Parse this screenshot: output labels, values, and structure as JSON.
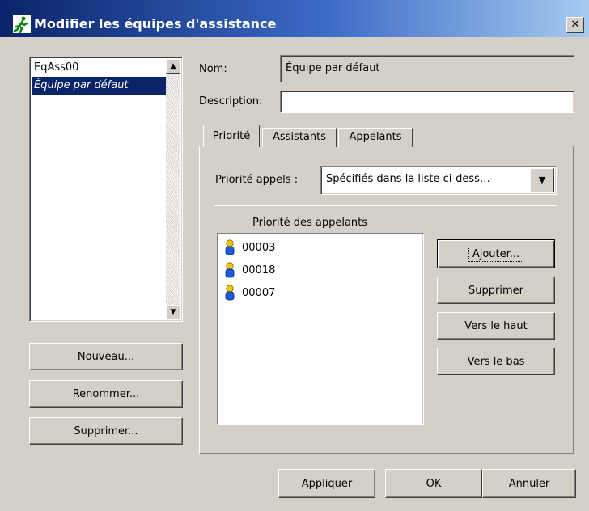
{
  "window": {
    "title": "Modifier les équipes d'assistance",
    "close_glyph": "✕"
  },
  "teams": {
    "items": [
      {
        "label": "EqAss00",
        "selected": false
      },
      {
        "label": "Équipe par défaut",
        "selected": true
      }
    ],
    "buttons": {
      "new": "Nouveau...",
      "rename": "Renommer...",
      "delete": "Supprimer..."
    }
  },
  "form": {
    "name_label": "Nom:",
    "name_value": "Équipe par défaut",
    "description_label": "Description:",
    "description_value": ""
  },
  "tabs": [
    {
      "label": "Priorité",
      "active": true
    },
    {
      "label": "Assistants",
      "active": false
    },
    {
      "label": "Appelants",
      "active": false
    }
  ],
  "priority_tab": {
    "calls_priority_label": "Priorité appels :",
    "calls_priority_value": "Spécifiés dans la liste ci-dess…",
    "callers_header": "Priorité des appelants",
    "callers": [
      "00003",
      "00018",
      "00007"
    ],
    "buttons": {
      "add": "Ajouter...",
      "remove": "Supprimer",
      "up": "Vers le haut",
      "down": "Vers le bas"
    }
  },
  "footer": {
    "apply": "Appliquer",
    "ok": "OK",
    "cancel": "Annuler"
  },
  "icons": {
    "app": "running-man-icon",
    "caller": "user-icon",
    "combo_arrow": "chevron-down-icon"
  },
  "colors": {
    "title_bar_start": "#0a246a",
    "title_bar_end": "#a6caf0",
    "dialog_bg": "#d4d0c8",
    "selection": "#0a246a",
    "app_icon": "#008000"
  }
}
